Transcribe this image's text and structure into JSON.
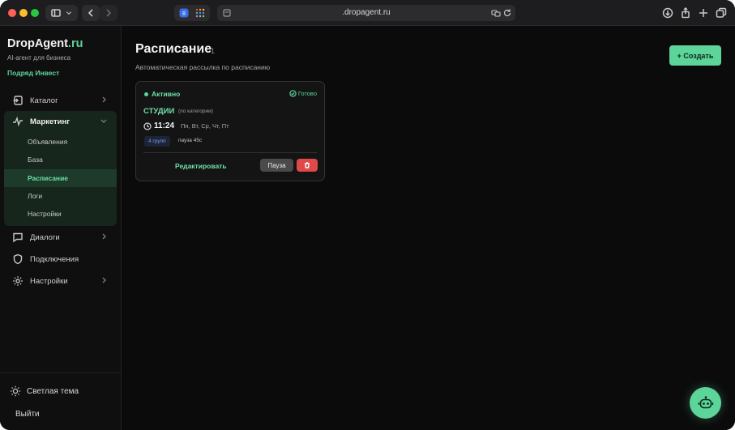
{
  "browser": {
    "url": ".dropagent.ru"
  },
  "sidebar": {
    "brand_name": "DropAgent",
    "brand_tld": ".ru",
    "brand_subtitle": "AI-агент для бизнеса",
    "company": "Подряд Инвест",
    "items": [
      {
        "label": "Каталог",
        "icon": "catalog-icon",
        "expandable": true
      },
      {
        "label": "Маркетинг",
        "icon": "pulse-icon",
        "expanded": true
      },
      {
        "label": "Диалоги",
        "icon": "chat-icon",
        "expandable": true
      },
      {
        "label": "Подключения",
        "icon": "shield-icon"
      },
      {
        "label": "Настройки",
        "icon": "gear-icon",
        "expandable": true
      }
    ],
    "marketing_sub": [
      {
        "label": "Объявления"
      },
      {
        "label": "База"
      },
      {
        "label": "Расписание",
        "active": true
      },
      {
        "label": "Логи"
      },
      {
        "label": "Настройки"
      }
    ],
    "theme_toggle": "Светлая тема",
    "logout": "Выйти"
  },
  "main": {
    "title": "Расписание",
    "count": "1",
    "subtitle": "Автоматическая рассылка по расписанию",
    "create_button": "+ Создать",
    "card": {
      "status": "Активно",
      "ready": "Готово",
      "segment": "СТУДИИ",
      "segment_note": "(по категории)",
      "time": "11:24",
      "days": "Пн, Вт, Ср, Чт, Пт",
      "groups_badge": "4 групп",
      "pause_info": "пауза 45с",
      "edit_label": "Редактировать",
      "pause_label": "Пауза"
    }
  },
  "colors": {
    "accent": "#5cd49a",
    "danger": "#e0494a",
    "background": "#0b0b0b",
    "groups_badge": "#7f9cf0"
  }
}
